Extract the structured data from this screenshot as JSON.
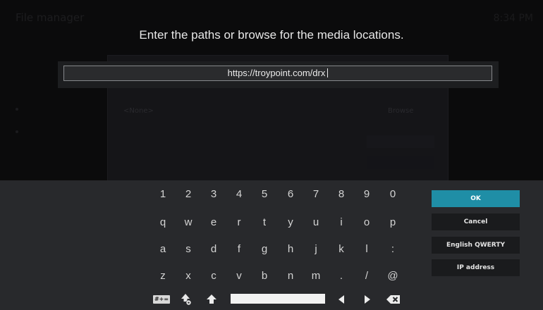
{
  "dialog": {
    "heading": "Enter the paths or browse for the media locations.",
    "input_value": "https://troypoint.com/drx"
  },
  "background": {
    "window_title": "File manager",
    "clock": "8:34 PM",
    "path_placeholder": "<None>",
    "browse_label": "Browse"
  },
  "keyboard": {
    "rows": [
      [
        "1",
        "2",
        "3",
        "4",
        "5",
        "6",
        "7",
        "8",
        "9",
        "0"
      ],
      [
        "q",
        "w",
        "e",
        "r",
        "t",
        "y",
        "u",
        "i",
        "o",
        "p"
      ],
      [
        "a",
        "s",
        "d",
        "f",
        "g",
        "h",
        "j",
        "k",
        "l",
        ":"
      ],
      [
        "z",
        "x",
        "c",
        "v",
        "b",
        "n",
        "m",
        ".",
        "/",
        "@"
      ]
    ],
    "symbols_label": "#+=",
    "icons": {
      "symbols": "symbols-toggle-icon",
      "shift_lock": "shift-lock-icon",
      "shift": "shift-icon",
      "left": "cursor-left-icon",
      "right": "cursor-right-icon",
      "backspace": "backspace-icon"
    }
  },
  "buttons": {
    "ok": "OK",
    "cancel": "Cancel",
    "layout": "English QWERTY",
    "ip": "IP address"
  },
  "colors": {
    "accent": "#1f8ea6",
    "panel": "#28292c",
    "button": "#1a1b1d"
  }
}
